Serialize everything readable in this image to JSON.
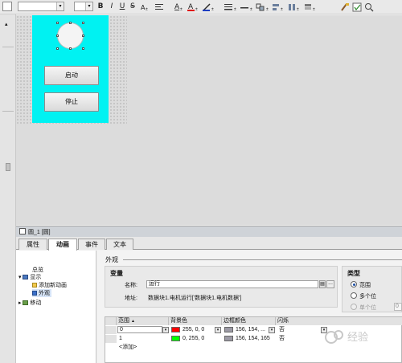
{
  "toolbar": {
    "buttons": [
      "B",
      "I",
      "U",
      "S"
    ],
    "icon_names": [
      "text-size-icon",
      "text-align-icon",
      "font-color-icon",
      "fill-color-icon",
      "line-color-icon",
      "line-style-icon",
      "line-width-icon",
      "group-icon",
      "align-icon",
      "distribute-icon",
      "layer-icon",
      "format-painter-icon",
      "check-icon",
      "zoom-icon"
    ]
  },
  "hmi_screen": {
    "background_color": "#00f2f2",
    "start_button_label": "启动",
    "stop_button_label": "停止"
  },
  "panel": {
    "title": "圆_1 [圆]",
    "tabs": [
      "属性",
      "动画",
      "事件",
      "文本"
    ],
    "active_tab": "动画"
  },
  "tree": {
    "overview": "总览",
    "display": "显示",
    "add_animation": "添加新动画",
    "appearance": "外观",
    "move": "移动"
  },
  "appearance": {
    "section_title": "外观",
    "variable_title": "变量",
    "name_label": "名称:",
    "name_value": "运行",
    "address_label": "地址:",
    "address_value": "数据块1.电机运行['数据块1.电机数据']",
    "browse_button": "...",
    "type_title": "类型",
    "type_options": [
      "范围",
      "多个位",
      "单个位"
    ],
    "type_selected": "范围",
    "single_bit_value": "0"
  },
  "table": {
    "columns": [
      "范围",
      "背景色",
      "边框颜色",
      "闪烁"
    ],
    "rows": [
      {
        "range": "0",
        "background": "255, 0, 0",
        "background_color": "#ff0000",
        "border": "156, 154, ...",
        "border_color": "#9c9aa5",
        "blink": "否"
      },
      {
        "range": "1",
        "background": "0, 255, 0",
        "background_color": "#00ff00",
        "border": "156, 154, 165",
        "border_color": "#9c9aa5",
        "blink": "否"
      }
    ],
    "add_row": "<添加>"
  },
  "watermark": "经验"
}
